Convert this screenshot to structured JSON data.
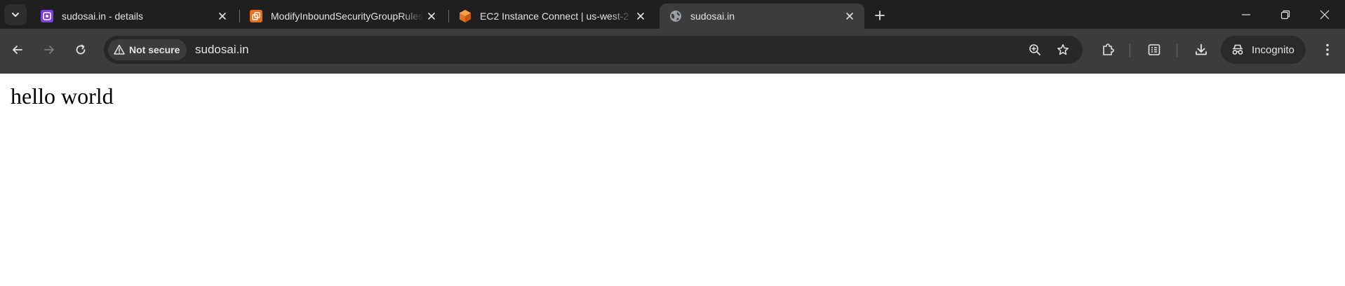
{
  "tabs": [
    {
      "title": "sudosai.in - details",
      "favicon": "purple-app-icon",
      "active": false
    },
    {
      "title": "ModifyInboundSecurityGroupRules",
      "favicon": "aws-vpc-icon",
      "active": false
    },
    {
      "title": "EC2 Instance Connect | us-west-2",
      "favicon": "aws-ec2-icon",
      "active": false
    },
    {
      "title": "sudosai.in",
      "favicon": "globe-icon",
      "active": true
    }
  ],
  "toolbar": {
    "security_label": "Not secure",
    "url": "sudosai.in",
    "incognito_label": "Incognito"
  },
  "page": {
    "text": "hello world"
  },
  "colors": {
    "tabstrip_bg": "#1f1f1f",
    "toolbar_bg": "#3c3c3c",
    "omnibox_bg": "#282828",
    "text": "#e3e3e3",
    "favicon_purple": "#7b3fe4",
    "favicon_aws": "#e8701a"
  }
}
